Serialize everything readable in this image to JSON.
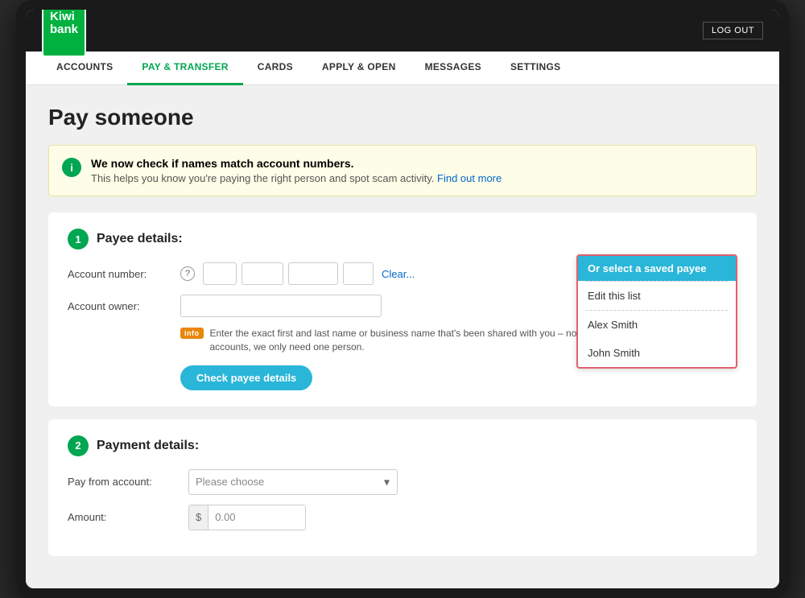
{
  "meta": {
    "title": "Kiwibank - Pay Someone"
  },
  "topbar": {
    "logout_label": "LOG OUT",
    "logo_line1": "Kiwi",
    "logo_line2": "bank."
  },
  "nav": {
    "items": [
      {
        "id": "accounts",
        "label": "ACCOUNTS",
        "active": false
      },
      {
        "id": "pay-transfer",
        "label": "PAY & TRANSFER",
        "active": true
      },
      {
        "id": "cards",
        "label": "CARDS",
        "active": false
      },
      {
        "id": "apply-open",
        "label": "APPLY & OPEN",
        "active": false
      },
      {
        "id": "messages",
        "label": "MESSAGES",
        "active": false
      },
      {
        "id": "settings",
        "label": "SETTINGS",
        "active": false
      }
    ]
  },
  "page": {
    "title": "Pay someone"
  },
  "info_banner": {
    "title": "We now check if names match account numbers.",
    "description": "This helps you know you're paying the right person and spot scam activity.",
    "link_text": "Find out more"
  },
  "section1": {
    "number": "1",
    "title": "Payee details:",
    "account_number_label": "Account number:",
    "help_tooltip": "?",
    "clear_link": "Clear...",
    "account_owner_label": "Account owner:",
    "info_badge": "info",
    "info_text": "Enter the exact first and last name or business name that's been shared with you – no initials or nicknames. For joint accounts, we only need one person.",
    "check_button": "Check payee details",
    "saved_payee_button": "Or select a saved payee",
    "edit_list": "Edit this list",
    "payees": [
      {
        "name": "Alex Smith"
      },
      {
        "name": "John Smith"
      }
    ]
  },
  "section2": {
    "number": "2",
    "title": "Payment details:",
    "pay_from_label": "Pay from account:",
    "pay_from_placeholder": "Please choose",
    "amount_label": "Amount:",
    "amount_prefix": "$",
    "amount_placeholder": "0.00"
  }
}
